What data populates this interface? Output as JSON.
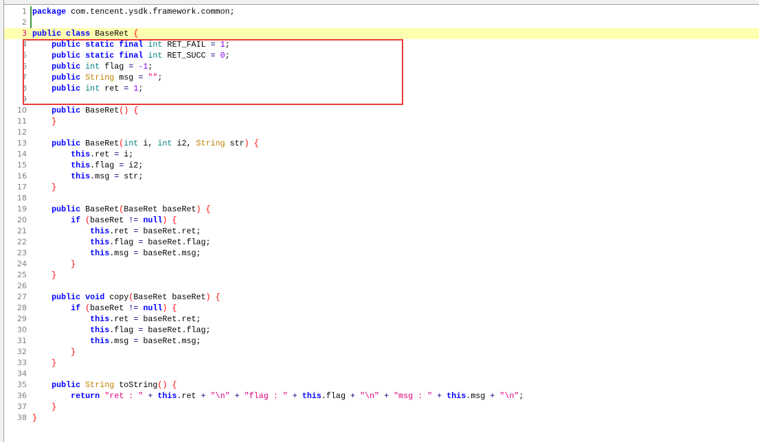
{
  "editor": {
    "current_line": 3,
    "highlight_lines": [
      4,
      9
    ],
    "colors": {
      "keyword": "#0000ff",
      "type": "#008080",
      "class": "#c08000",
      "number": "#8000ff",
      "string": "#e0007f",
      "operator": "#000080",
      "brace": "#ff0000",
      "highlight_box": "#e83a3a",
      "current_line": "#ffffb0"
    },
    "lines": [
      [
        [
          "k",
          "package"
        ],
        [
          "p",
          " com.tencent.ysdk.framework.common;"
        ]
      ],
      [],
      [
        [
          "k",
          "public"
        ],
        [
          "p",
          " "
        ],
        [
          "k",
          "class"
        ],
        [
          "p",
          " BaseRet "
        ],
        [
          "b",
          "{"
        ]
      ],
      [
        [
          "p",
          "    "
        ],
        [
          "k",
          "public"
        ],
        [
          "p",
          " "
        ],
        [
          "k",
          "static"
        ],
        [
          "p",
          " "
        ],
        [
          "k",
          "final"
        ],
        [
          "p",
          " "
        ],
        [
          "t",
          "int"
        ],
        [
          "p",
          " RET_FAIL "
        ],
        [
          "o",
          "="
        ],
        [
          "p",
          " "
        ],
        [
          "n",
          "1"
        ],
        [
          "p",
          ";"
        ]
      ],
      [
        [
          "p",
          "    "
        ],
        [
          "k",
          "public"
        ],
        [
          "p",
          " "
        ],
        [
          "k",
          "static"
        ],
        [
          "p",
          " "
        ],
        [
          "k",
          "final"
        ],
        [
          "p",
          " "
        ],
        [
          "t",
          "int"
        ],
        [
          "p",
          " RET_SUCC "
        ],
        [
          "o",
          "="
        ],
        [
          "p",
          " "
        ],
        [
          "n",
          "0"
        ],
        [
          "p",
          ";"
        ]
      ],
      [
        [
          "p",
          "    "
        ],
        [
          "k",
          "public"
        ],
        [
          "p",
          " "
        ],
        [
          "t",
          "int"
        ],
        [
          "p",
          " flag "
        ],
        [
          "o",
          "="
        ],
        [
          "p",
          " "
        ],
        [
          "n",
          "-1"
        ],
        [
          "p",
          ";"
        ]
      ],
      [
        [
          "p",
          "    "
        ],
        [
          "k",
          "public"
        ],
        [
          "p",
          " "
        ],
        [
          "s",
          "String"
        ],
        [
          "p",
          " msg "
        ],
        [
          "o",
          "="
        ],
        [
          "p",
          " "
        ],
        [
          "q",
          "\"\""
        ],
        [
          "p",
          ";"
        ]
      ],
      [
        [
          "p",
          "    "
        ],
        [
          "k",
          "public"
        ],
        [
          "p",
          " "
        ],
        [
          "t",
          "int"
        ],
        [
          "p",
          " ret "
        ],
        [
          "o",
          "="
        ],
        [
          "p",
          " "
        ],
        [
          "n",
          "1"
        ],
        [
          "p",
          ";"
        ]
      ],
      [],
      [
        [
          "p",
          "    "
        ],
        [
          "k",
          "public"
        ],
        [
          "p",
          " BaseRet"
        ],
        [
          "b",
          "()"
        ],
        [
          "p",
          " "
        ],
        [
          "b",
          "{"
        ]
      ],
      [
        [
          "p",
          "    "
        ],
        [
          "b",
          "}"
        ]
      ],
      [],
      [
        [
          "p",
          "    "
        ],
        [
          "k",
          "public"
        ],
        [
          "p",
          " BaseRet"
        ],
        [
          "b",
          "("
        ],
        [
          "t",
          "int"
        ],
        [
          "p",
          " i, "
        ],
        [
          "t",
          "int"
        ],
        [
          "p",
          " i2, "
        ],
        [
          "s",
          "String"
        ],
        [
          "p",
          " str"
        ],
        [
          "b",
          ")"
        ],
        [
          "p",
          " "
        ],
        [
          "b",
          "{"
        ]
      ],
      [
        [
          "p",
          "        "
        ],
        [
          "k",
          "this"
        ],
        [
          "p",
          ".ret "
        ],
        [
          "o",
          "="
        ],
        [
          "p",
          " i;"
        ]
      ],
      [
        [
          "p",
          "        "
        ],
        [
          "k",
          "this"
        ],
        [
          "p",
          ".flag "
        ],
        [
          "o",
          "="
        ],
        [
          "p",
          " i2;"
        ]
      ],
      [
        [
          "p",
          "        "
        ],
        [
          "k",
          "this"
        ],
        [
          "p",
          ".msg "
        ],
        [
          "o",
          "="
        ],
        [
          "p",
          " str;"
        ]
      ],
      [
        [
          "p",
          "    "
        ],
        [
          "b",
          "}"
        ]
      ],
      [],
      [
        [
          "p",
          "    "
        ],
        [
          "k",
          "public"
        ],
        [
          "p",
          " BaseRet"
        ],
        [
          "b",
          "("
        ],
        [
          "p",
          "BaseRet baseRet"
        ],
        [
          "b",
          ")"
        ],
        [
          "p",
          " "
        ],
        [
          "b",
          "{"
        ]
      ],
      [
        [
          "p",
          "        "
        ],
        [
          "k",
          "if"
        ],
        [
          "p",
          " "
        ],
        [
          "b",
          "("
        ],
        [
          "p",
          "baseRet "
        ],
        [
          "o",
          "!="
        ],
        [
          "p",
          " "
        ],
        [
          "k",
          "null"
        ],
        [
          "b",
          ")"
        ],
        [
          "p",
          " "
        ],
        [
          "b",
          "{"
        ]
      ],
      [
        [
          "p",
          "            "
        ],
        [
          "k",
          "this"
        ],
        [
          "p",
          ".ret "
        ],
        [
          "o",
          "="
        ],
        [
          "p",
          " baseRet.ret;"
        ]
      ],
      [
        [
          "p",
          "            "
        ],
        [
          "k",
          "this"
        ],
        [
          "p",
          ".flag "
        ],
        [
          "o",
          "="
        ],
        [
          "p",
          " baseRet.flag;"
        ]
      ],
      [
        [
          "p",
          "            "
        ],
        [
          "k",
          "this"
        ],
        [
          "p",
          ".msg "
        ],
        [
          "o",
          "="
        ],
        [
          "p",
          " baseRet.msg;"
        ]
      ],
      [
        [
          "p",
          "        "
        ],
        [
          "b",
          "}"
        ]
      ],
      [
        [
          "p",
          "    "
        ],
        [
          "b",
          "}"
        ]
      ],
      [],
      [
        [
          "p",
          "    "
        ],
        [
          "k",
          "public"
        ],
        [
          "p",
          " "
        ],
        [
          "k",
          "void"
        ],
        [
          "p",
          " copy"
        ],
        [
          "b",
          "("
        ],
        [
          "p",
          "BaseRet baseRet"
        ],
        [
          "b",
          ")"
        ],
        [
          "p",
          " "
        ],
        [
          "b",
          "{"
        ]
      ],
      [
        [
          "p",
          "        "
        ],
        [
          "k",
          "if"
        ],
        [
          "p",
          " "
        ],
        [
          "b",
          "("
        ],
        [
          "p",
          "baseRet "
        ],
        [
          "o",
          "!="
        ],
        [
          "p",
          " "
        ],
        [
          "k",
          "null"
        ],
        [
          "b",
          ")"
        ],
        [
          "p",
          " "
        ],
        [
          "b",
          "{"
        ]
      ],
      [
        [
          "p",
          "            "
        ],
        [
          "k",
          "this"
        ],
        [
          "p",
          ".ret "
        ],
        [
          "o",
          "="
        ],
        [
          "p",
          " baseRet.ret;"
        ]
      ],
      [
        [
          "p",
          "            "
        ],
        [
          "k",
          "this"
        ],
        [
          "p",
          ".flag "
        ],
        [
          "o",
          "="
        ],
        [
          "p",
          " baseRet.flag;"
        ]
      ],
      [
        [
          "p",
          "            "
        ],
        [
          "k",
          "this"
        ],
        [
          "p",
          ".msg "
        ],
        [
          "o",
          "="
        ],
        [
          "p",
          " baseRet.msg;"
        ]
      ],
      [
        [
          "p",
          "        "
        ],
        [
          "b",
          "}"
        ]
      ],
      [
        [
          "p",
          "    "
        ],
        [
          "b",
          "}"
        ]
      ],
      [],
      [
        [
          "p",
          "    "
        ],
        [
          "k",
          "public"
        ],
        [
          "p",
          " "
        ],
        [
          "s",
          "String"
        ],
        [
          "p",
          " toString"
        ],
        [
          "b",
          "()"
        ],
        [
          "p",
          " "
        ],
        [
          "b",
          "{"
        ]
      ],
      [
        [
          "p",
          "        "
        ],
        [
          "k",
          "return"
        ],
        [
          "p",
          " "
        ],
        [
          "q",
          "\"ret : \""
        ],
        [
          "p",
          " "
        ],
        [
          "o",
          "+"
        ],
        [
          "p",
          " "
        ],
        [
          "k",
          "this"
        ],
        [
          "p",
          ".ret "
        ],
        [
          "o",
          "+"
        ],
        [
          "p",
          " "
        ],
        [
          "q",
          "\"\\n\""
        ],
        [
          "p",
          " "
        ],
        [
          "o",
          "+"
        ],
        [
          "p",
          " "
        ],
        [
          "q",
          "\"flag : \""
        ],
        [
          "p",
          " "
        ],
        [
          "o",
          "+"
        ],
        [
          "p",
          " "
        ],
        [
          "k",
          "this"
        ],
        [
          "p",
          ".flag "
        ],
        [
          "o",
          "+"
        ],
        [
          "p",
          " "
        ],
        [
          "q",
          "\"\\n\""
        ],
        [
          "p",
          " "
        ],
        [
          "o",
          "+"
        ],
        [
          "p",
          " "
        ],
        [
          "q",
          "\"msg : \""
        ],
        [
          "p",
          " "
        ],
        [
          "o",
          "+"
        ],
        [
          "p",
          " "
        ],
        [
          "k",
          "this"
        ],
        [
          "p",
          ".msg "
        ],
        [
          "o",
          "+"
        ],
        [
          "p",
          " "
        ],
        [
          "q",
          "\"\\n\""
        ],
        [
          "p",
          ";"
        ]
      ],
      [
        [
          "p",
          "    "
        ],
        [
          "b",
          "}"
        ]
      ],
      [
        [
          "b",
          "}"
        ]
      ]
    ]
  }
}
